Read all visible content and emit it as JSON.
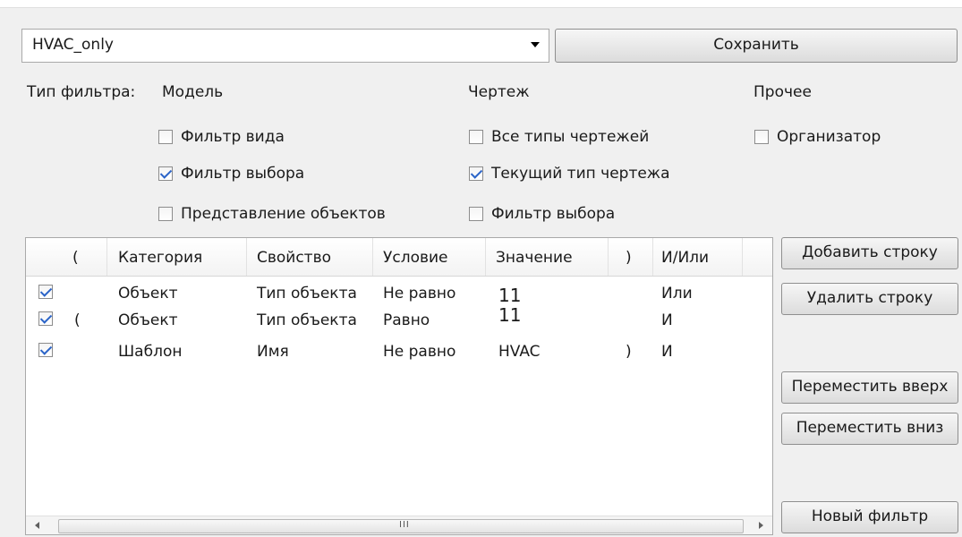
{
  "filter": {
    "name": "HVAC_only",
    "save_label": "Сохранить"
  },
  "filter_type": {
    "label": "Тип фильтра:",
    "groups": [
      {
        "title": "Модель",
        "options": [
          {
            "label": "Фильтр вида",
            "checked": false
          },
          {
            "label": "Фильтр выбора",
            "checked": true
          },
          {
            "label": "Представление объектов",
            "checked": false
          }
        ]
      },
      {
        "title": "Чертеж",
        "options": [
          {
            "label": "Все типы чертежей",
            "checked": false
          },
          {
            "label": "Текущий тип чертежа",
            "checked": true
          },
          {
            "label": "Фильтр выбора",
            "checked": false
          }
        ]
      },
      {
        "title": "Прочее",
        "options": [
          {
            "label": "Организатор",
            "checked": false
          }
        ]
      }
    ]
  },
  "table": {
    "columns": [
      "(",
      "Категория",
      "Свойство",
      "Условие",
      "Значение",
      ")",
      "И/Или"
    ],
    "rows": [
      {
        "checked": true,
        "open": "",
        "category": "Объект",
        "property": "Тип объекта",
        "condition": "Не равно",
        "value": "11",
        "close": "",
        "logic": "Или"
      },
      {
        "checked": true,
        "open": "(",
        "category": "Объект",
        "property": "Тип объекта",
        "condition": "Равно",
        "value": "11",
        "close": "",
        "logic": "И"
      },
      {
        "checked": true,
        "open": "",
        "category": "Шаблон",
        "property": "Имя",
        "condition": "Не равно",
        "value": "HVAC",
        "close": ")",
        "logic": "И"
      }
    ],
    "scroll_grip": "III"
  },
  "actions": {
    "add_row": "Добавить строку",
    "delete_row": "Удалить строку",
    "move_up": "Переместить вверх",
    "move_down": "Переместить вниз",
    "new_filter": "Новый фильтр"
  },
  "colors": {
    "check": "#2b64c8",
    "background": "#f0f0f0"
  }
}
